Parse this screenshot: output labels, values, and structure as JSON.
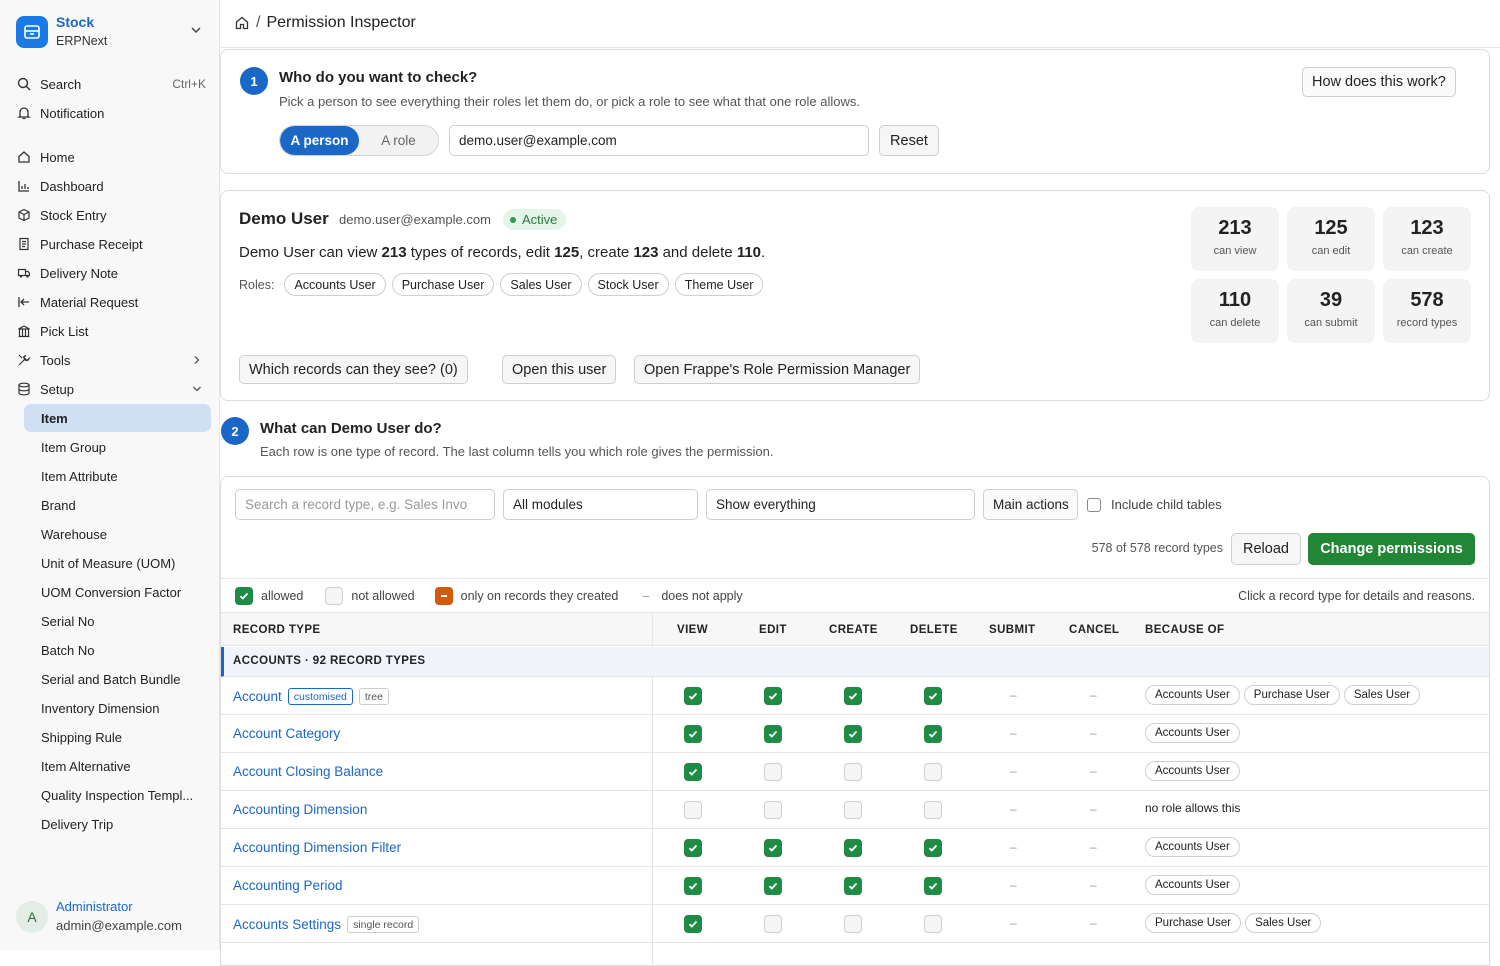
{
  "app": {
    "name": "Stock",
    "sub": "ERPNext"
  },
  "sidebar": {
    "search_label": "Search",
    "search_kbd": "Ctrl+K",
    "notification_label": "Notification",
    "nav": [
      "Home",
      "Dashboard",
      "Stock Entry",
      "Purchase Receipt",
      "Delivery Note",
      "Material Request",
      "Pick List",
      "Tools",
      "Setup"
    ],
    "setup_items": [
      "Item",
      "Item Group",
      "Item Attribute",
      "Brand",
      "Warehouse",
      "Unit of Measure (UOM)",
      "UOM Conversion Factor",
      "Serial No",
      "Batch No",
      "Serial and Batch Bundle",
      "Inventory Dimension",
      "Shipping Rule",
      "Item Alternative",
      "Quality Inspection Templ...",
      "Delivery Trip"
    ],
    "user": {
      "initial": "A",
      "name": "Administrator",
      "email": "admin@example.com"
    }
  },
  "breadcrumb": {
    "sep": "/",
    "title": "Permission Inspector"
  },
  "step1": {
    "num": "1",
    "title": "Who do you want to check?",
    "subtitle": "Pick a person to see everything their roles let them do, or pick a role to see what that one role allows.",
    "how_button": "How does this work?",
    "seg_person": "A person",
    "seg_role": "A role",
    "user_value": "demo.user@example.com",
    "reset": "Reset"
  },
  "user_card": {
    "name": "Demo User",
    "email": "demo.user@example.com",
    "status": "Active",
    "summary": {
      "prefix": "Demo User can view ",
      "view": "213",
      "t1": " types of records, edit ",
      "edit": "125",
      "t2": ", create ",
      "create": "123",
      "t3": " and delete ",
      "delete": "110",
      "t4": "."
    },
    "roles_label": "Roles:",
    "roles": [
      "Accounts User",
      "Purchase User",
      "Sales User",
      "Stock User",
      "Theme User"
    ],
    "buttons": {
      "records": "Which records can they see? (0)",
      "open_user": "Open this user",
      "role_manager": "Open Frappe's Role Permission Manager"
    },
    "stats": [
      {
        "n": "213",
        "l": "can view"
      },
      {
        "n": "125",
        "l": "can edit"
      },
      {
        "n": "123",
        "l": "can create"
      },
      {
        "n": "110",
        "l": "can delete"
      },
      {
        "n": "39",
        "l": "can submit"
      },
      {
        "n": "578",
        "l": "record types"
      }
    ]
  },
  "step2": {
    "num": "2",
    "title": "What can Demo User do?",
    "subtitle": "Each row is one type of record. The last column tells you which role gives the permission."
  },
  "filters": {
    "search_placeholder": "Search a record type, e.g. Sales Invo",
    "modules": "All modules",
    "show": "Show everything",
    "main_actions": "Main actions",
    "include_child": "Include child tables",
    "count": "578 of 578 record types",
    "reload": "Reload",
    "change": "Change permissions"
  },
  "legend": {
    "allowed": "allowed",
    "not_allowed": "not allowed",
    "own": "only on records they created",
    "dash": "–",
    "na": "does not apply",
    "hint": "Click a record type for details and reasons."
  },
  "table": {
    "headers": {
      "record_type": "RECORD TYPE",
      "view": "VIEW",
      "edit": "EDIT",
      "create": "CREATE",
      "delete": "DELETE",
      "submit": "SUBMIT",
      "cancel": "CANCEL",
      "because": "BECAUSE OF"
    },
    "group": "ACCOUNTS · 92 RECORD TYPES",
    "rows": [
      {
        "name": "Account",
        "tags": [
          "customised",
          "tree"
        ],
        "perms": [
          "y",
          "y",
          "y",
          "y"
        ],
        "submit": "–",
        "cancel": "–",
        "because": [
          "Accounts User",
          "Purchase User",
          "Sales User"
        ],
        "note": ""
      },
      {
        "name": "Account Category",
        "tags": [],
        "perms": [
          "y",
          "y",
          "y",
          "y"
        ],
        "submit": "–",
        "cancel": "–",
        "because": [
          "Accounts User"
        ],
        "note": ""
      },
      {
        "name": "Account Closing Balance",
        "tags": [],
        "perms": [
          "y",
          "n",
          "n",
          "n"
        ],
        "submit": "–",
        "cancel": "–",
        "because": [
          "Accounts User"
        ],
        "note": ""
      },
      {
        "name": "Accounting Dimension",
        "tags": [],
        "perms": [
          "n",
          "n",
          "n",
          "n"
        ],
        "submit": "–",
        "cancel": "–",
        "because": [],
        "note": "no role allows this"
      },
      {
        "name": "Accounting Dimension Filter",
        "tags": [],
        "perms": [
          "y",
          "y",
          "y",
          "y"
        ],
        "submit": "–",
        "cancel": "–",
        "because": [
          "Accounts User"
        ],
        "note": ""
      },
      {
        "name": "Accounting Period",
        "tags": [],
        "perms": [
          "y",
          "y",
          "y",
          "y"
        ],
        "submit": "–",
        "cancel": "–",
        "because": [
          "Accounts User"
        ],
        "note": ""
      },
      {
        "name": "Accounts Settings",
        "tags": [
          "single record"
        ],
        "perms": [
          "y",
          "n",
          "n",
          "n"
        ],
        "submit": "–",
        "cancel": "–",
        "because": [
          "Purchase User",
          "Sales User"
        ],
        "note": ""
      }
    ]
  },
  "colors": {
    "primary": "#1a67c8",
    "allowed": "#1f8c46",
    "own": "#d35b0e",
    "change_btn": "#238636"
  }
}
